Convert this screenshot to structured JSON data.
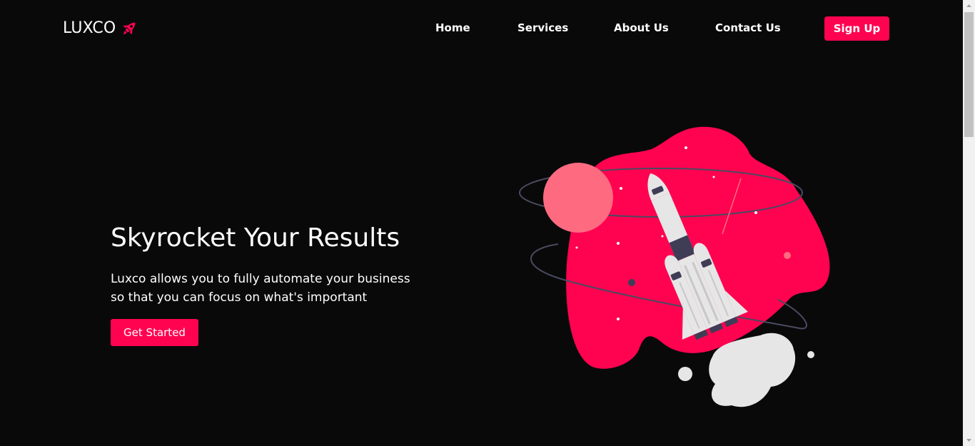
{
  "brand": {
    "name": "LUXCO",
    "icon": "rocket-icon",
    "accent_color": "#ff0350"
  },
  "nav": {
    "items": [
      {
        "label": "Home"
      },
      {
        "label": "Services"
      },
      {
        "label": "About Us"
      },
      {
        "label": "Contact Us"
      }
    ],
    "signup_label": "Sign Up"
  },
  "hero": {
    "title": "Skyrocket Your Results",
    "description": "Luxco allows you to fully automate your business so that you can focus on what's important",
    "cta_label": "Get Started",
    "illustration": "rocket-launch-illustration"
  },
  "colors": {
    "background": "#09090a",
    "accent": "#ff0350",
    "planet": "#fe6b81",
    "rocket_body": "#e6e6e6",
    "rocket_dark": "#3f3d56"
  }
}
